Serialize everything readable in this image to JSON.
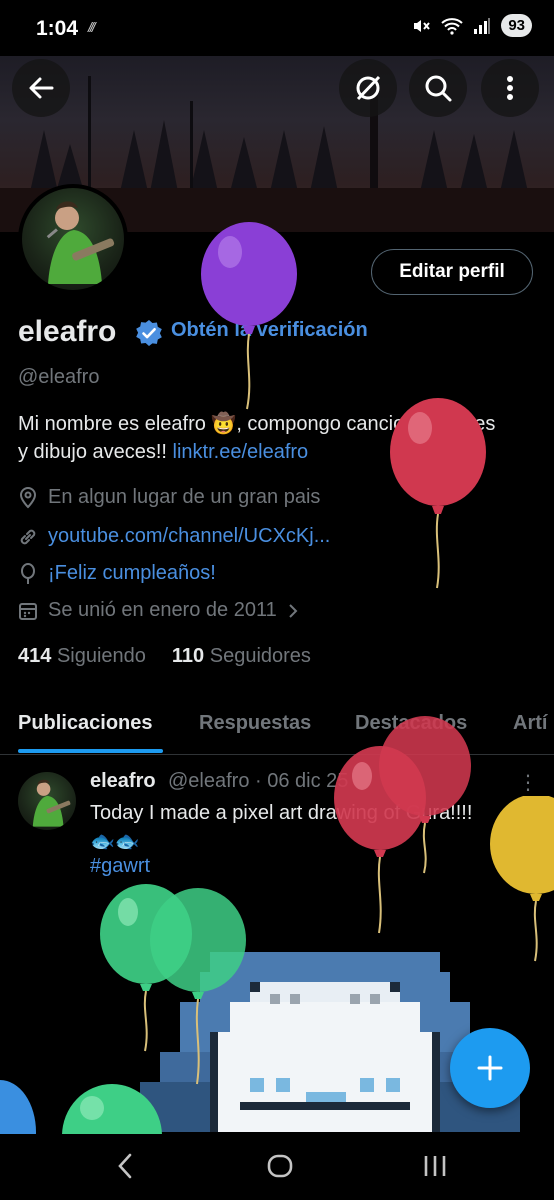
{
  "status_bar": {
    "time": "1:04",
    "extra": "///",
    "battery": "93"
  },
  "header": {
    "back_icon": "arrow-left-icon",
    "unknown_icon": "circle-slash-icon",
    "search_icon": "search-icon",
    "more_icon": "vertical-ellipsis-icon"
  },
  "profile": {
    "edit_button": "Editar perfil",
    "display_name": "eleafro",
    "verify_link": "Obtén la verificación",
    "handle": "@eleafro",
    "bio_text": "Mi nombre es eleafro 🤠, compongo canciones tristes y dibujo aveces!! ",
    "bio_link": "linktr.ee/eleafro",
    "location": "En algun lugar de un gran pais",
    "website": "youtube.com/channel/UCXcKj...",
    "birthday": "¡Feliz cumpleaños!",
    "joined": "Se unió en enero de 2011",
    "following_count": "414",
    "following_label": "Siguiendo",
    "followers_count": "110",
    "followers_label": "Seguidores"
  },
  "tabs": [
    "Publicaciones",
    "Respuestas",
    "Destacados",
    "Artí"
  ],
  "post": {
    "author": "eleafro",
    "handle_date": "@eleafro · 06 dic 25",
    "text": "Today I made a pixel art drawing of Gura!!!!",
    "emoji": "🐟🐟",
    "hashtag": "#gawrt",
    "menu": "⋮"
  },
  "colors": {
    "accent": "#1d9bf0",
    "link": "#4a8fe0",
    "muted": "#71767b",
    "background": "#000000",
    "balloon_purple": "#8a3fd6",
    "balloon_red": "#d0384f",
    "balloon_green": "#3ecf86",
    "balloon_yellow": "#e0b830",
    "balloon_blue": "#3a8fe0"
  }
}
